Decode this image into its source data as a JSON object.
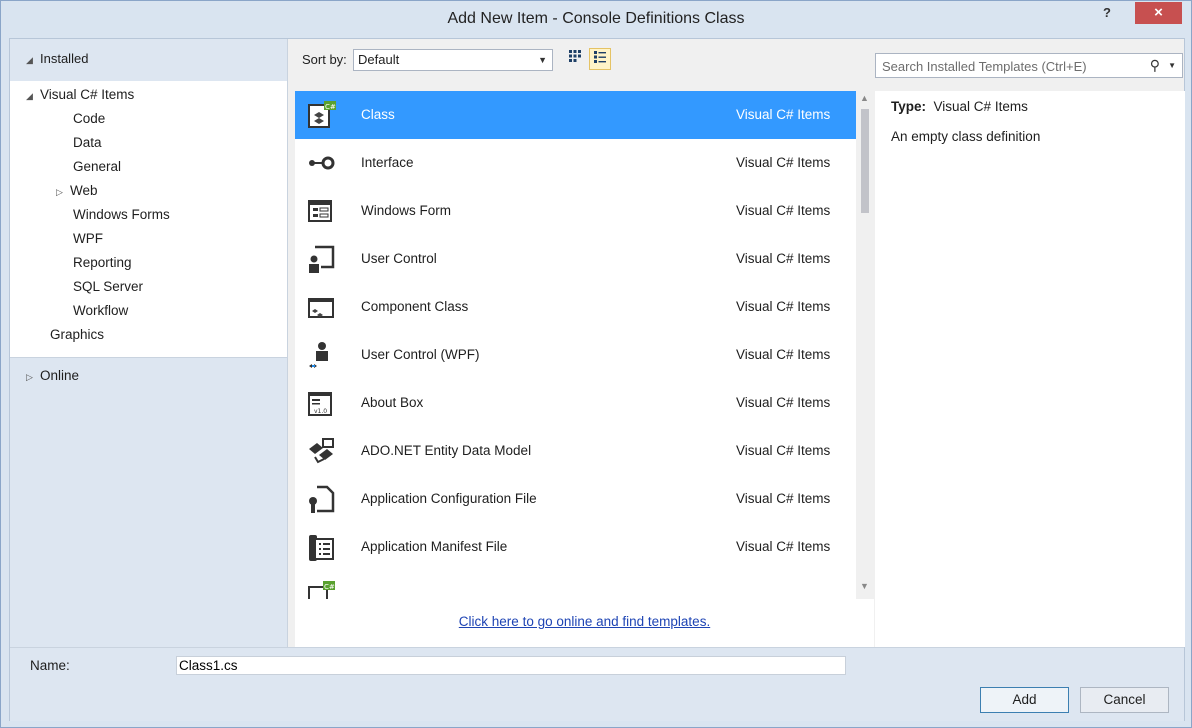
{
  "window": {
    "title": "Add New Item - Console Definitions Class",
    "help": "?",
    "close": "×"
  },
  "tree": {
    "installed": "Installed",
    "root": "Visual C# Items",
    "children": [
      "Code",
      "Data",
      "General",
      "Web",
      "Windows Forms",
      "WPF",
      "Reporting",
      "SQL Server",
      "Workflow"
    ],
    "graphics": "Graphics",
    "online": "Online"
  },
  "toolbar": {
    "sort_label": "Sort by:",
    "sort_value": "Default"
  },
  "search": {
    "placeholder": "Search Installed Templates (Ctrl+E)"
  },
  "templates": [
    {
      "name": "Class",
      "category": "Visual C# Items",
      "icon": "class-icon"
    },
    {
      "name": "Interface",
      "category": "Visual C# Items",
      "icon": "interface-icon"
    },
    {
      "name": "Windows Form",
      "category": "Visual C# Items",
      "icon": "windows-form-icon"
    },
    {
      "name": "User Control",
      "category": "Visual C# Items",
      "icon": "user-control-icon"
    },
    {
      "name": "Component Class",
      "category": "Visual C# Items",
      "icon": "component-class-icon"
    },
    {
      "name": "User Control (WPF)",
      "category": "Visual C# Items",
      "icon": "user-control-wpf-icon"
    },
    {
      "name": "About Box",
      "category": "Visual C# Items",
      "icon": "about-box-icon"
    },
    {
      "name": "ADO.NET Entity Data Model",
      "category": "Visual C# Items",
      "icon": "entity-model-icon"
    },
    {
      "name": "Application Configuration File",
      "category": "Visual C# Items",
      "icon": "config-file-icon"
    },
    {
      "name": "Application Manifest File",
      "category": "Visual C# Items",
      "icon": "manifest-file-icon"
    }
  ],
  "online_link": "Click here to go online and find templates.",
  "details": {
    "type_label": "Type:",
    "type_value": "Visual C# Items",
    "description": "An empty class definition"
  },
  "name_field": {
    "label": "Name:",
    "value": "Class1.cs"
  },
  "buttons": {
    "add": "Add",
    "cancel": "Cancel"
  },
  "colors": {
    "selection": "#3399ff",
    "link": "#1e44b4",
    "close_button": "#c75050"
  }
}
